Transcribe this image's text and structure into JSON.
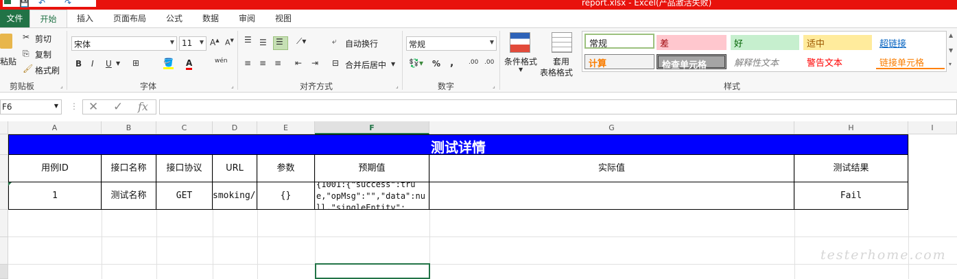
{
  "titlebar": {
    "title": "report.xlsx - Excel(产品激活失败)",
    "qat": [
      "save-icon",
      "undo-icon",
      "redo-icon"
    ]
  },
  "tabs": [
    {
      "label": "文件"
    },
    {
      "label": "开始"
    },
    {
      "label": "插入"
    },
    {
      "label": "页面布局"
    },
    {
      "label": "公式"
    },
    {
      "label": "数据"
    },
    {
      "label": "审阅"
    },
    {
      "label": "视图"
    }
  ],
  "ribbon": {
    "clipboard": {
      "paste": "粘贴",
      "cut": "剪切",
      "copy": "复制",
      "format_painter": "格式刷",
      "label": "剪贴板"
    },
    "font": {
      "name": "宋体",
      "size": "11",
      "bold": "B",
      "italic": "I",
      "underline": "U",
      "label": "字体",
      "phonetic": "wén"
    },
    "alignment": {
      "wrap": "自动换行",
      "merge": "合并后居中",
      "label": "对齐方式"
    },
    "number": {
      "format": "常规",
      "percent": "%",
      "comma": ",",
      "inc_decimal": ".00",
      "dec_decimal": ".00",
      "label": "数字"
    },
    "styles": {
      "conditional": "条件格式",
      "table_format_1": "套用",
      "table_format_2": "表格格式",
      "label": "样式",
      "cells": [
        {
          "text": "常规"
        },
        {
          "text": "差"
        },
        {
          "text": "好"
        },
        {
          "text": "适中"
        },
        {
          "text": "超链接"
        },
        {
          "text": "计算"
        },
        {
          "text": "检查单元格"
        },
        {
          "text": "解释性文本"
        },
        {
          "text": "警告文本"
        },
        {
          "text": "链接单元格"
        }
      ]
    }
  },
  "formula_bar": {
    "name_box": "F6",
    "fx": "fx",
    "formula": ""
  },
  "columns": [
    "A",
    "B",
    "C",
    "D",
    "E",
    "F",
    "G",
    "H",
    "I"
  ],
  "sheet": {
    "banner": "测试详情",
    "headers": [
      "用例ID",
      "接口名称",
      "接口协议",
      "URL",
      "参数",
      "预期值",
      "实际值",
      "测试结果"
    ],
    "row": [
      "1",
      "测试名称",
      "GET",
      "smoking/",
      "{}",
      "{1001:{\"success\":true,\"opMsg\":\"\",\"data\":null,\"singleEntity\":",
      "",
      "Fail"
    ]
  },
  "watermark": "testerhome.com"
}
